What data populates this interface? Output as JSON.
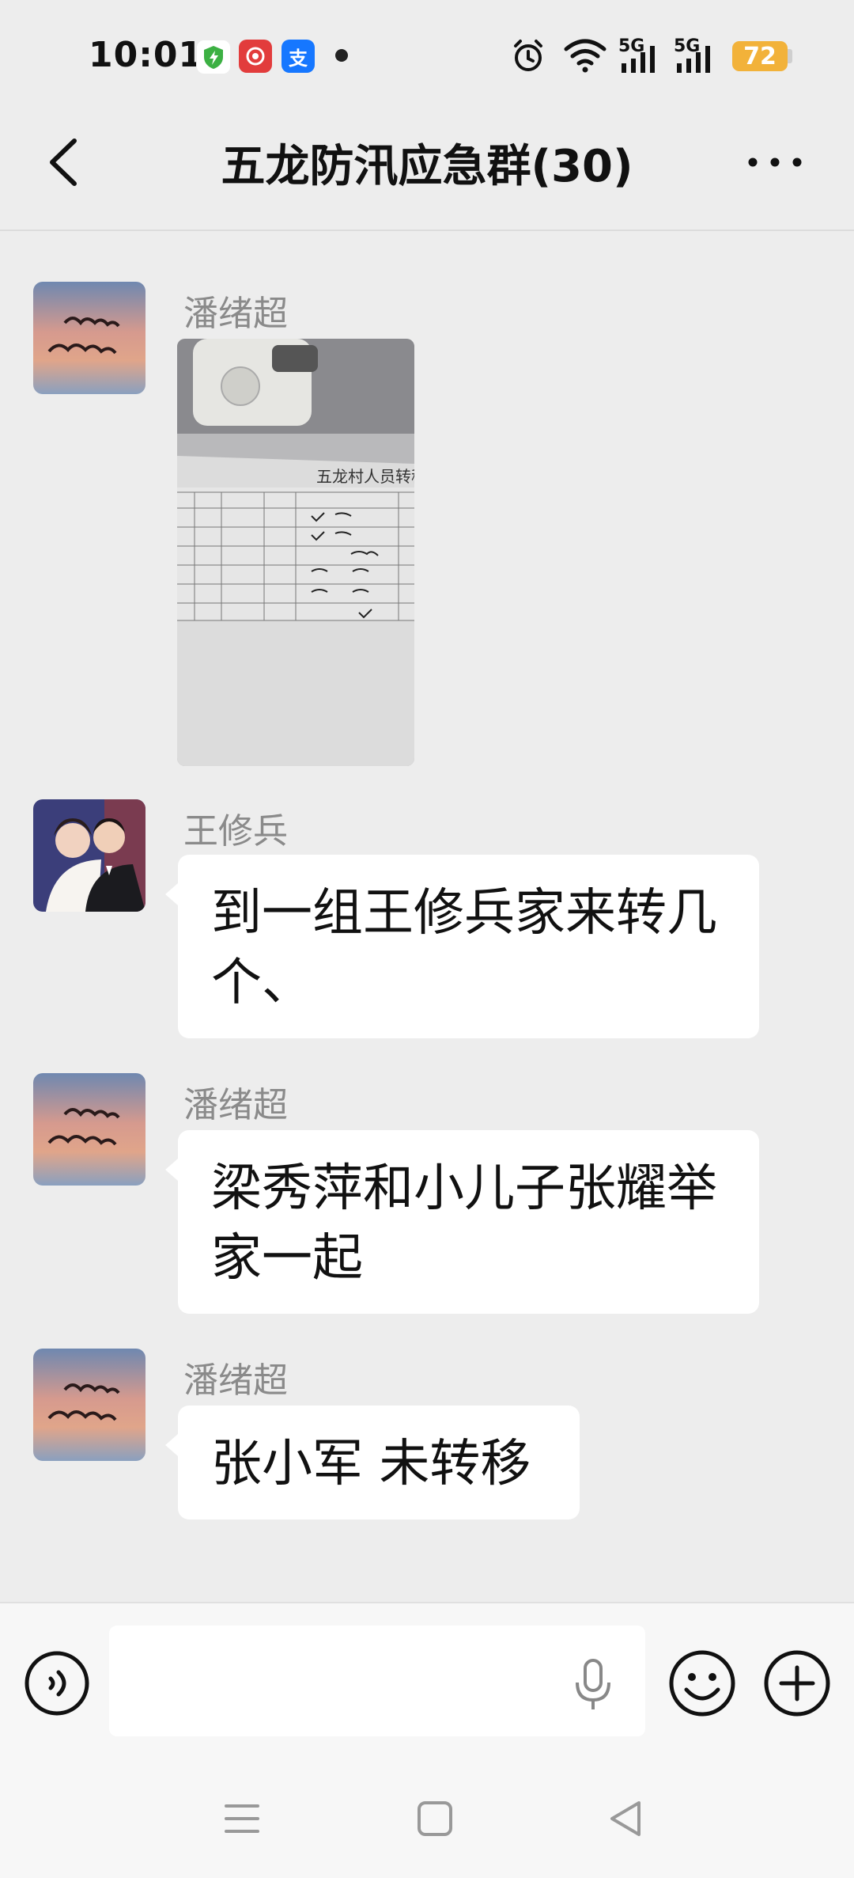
{
  "status_bar": {
    "time": "10:01",
    "network_1": "5G",
    "network_2": "5G",
    "battery": "72"
  },
  "header": {
    "title": "五龙防汛应急群(30)"
  },
  "messages": [
    {
      "sender": "潘绪超",
      "type": "image",
      "image_caption": "五龙村人员转移"
    },
    {
      "sender": "王修兵",
      "type": "text",
      "text": "到一组王修兵家来转几个、"
    },
    {
      "sender": "潘绪超",
      "type": "text",
      "text": "梁秀萍和小儿子张耀举家一起"
    },
    {
      "sender": "潘绪超",
      "type": "text",
      "text": "张小军 未转移"
    }
  ],
  "input": {
    "value": "",
    "placeholder": ""
  },
  "icons": {
    "back": "chevron-left-icon",
    "more": "more-dots-icon",
    "voice": "voice-icon",
    "mic": "mic-icon",
    "emoji": "emoji-icon",
    "plus": "plus-icon",
    "nav_menu": "menu-icon",
    "nav_home": "home-square-icon",
    "nav_back": "back-triangle-icon"
  },
  "colors": {
    "background": "#ededed",
    "bubble": "#ffffff",
    "battery": "#f2b23a"
  }
}
